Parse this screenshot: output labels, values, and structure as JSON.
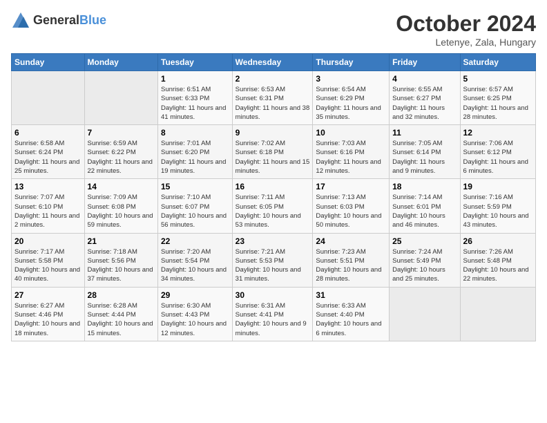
{
  "logo": {
    "text_general": "General",
    "text_blue": "Blue"
  },
  "title": "October 2024",
  "location": "Letenye, Zala, Hungary",
  "days_of_week": [
    "Sunday",
    "Monday",
    "Tuesday",
    "Wednesday",
    "Thursday",
    "Friday",
    "Saturday"
  ],
  "weeks": [
    {
      "days": [
        {
          "num": "",
          "empty": true
        },
        {
          "num": "",
          "empty": true
        },
        {
          "num": "1",
          "sunrise": "6:51 AM",
          "sunset": "6:33 PM",
          "daylight": "11 hours and 41 minutes."
        },
        {
          "num": "2",
          "sunrise": "6:53 AM",
          "sunset": "6:31 PM",
          "daylight": "11 hours and 38 minutes."
        },
        {
          "num": "3",
          "sunrise": "6:54 AM",
          "sunset": "6:29 PM",
          "daylight": "11 hours and 35 minutes."
        },
        {
          "num": "4",
          "sunrise": "6:55 AM",
          "sunset": "6:27 PM",
          "daylight": "11 hours and 32 minutes."
        },
        {
          "num": "5",
          "sunrise": "6:57 AM",
          "sunset": "6:25 PM",
          "daylight": "11 hours and 28 minutes."
        }
      ]
    },
    {
      "days": [
        {
          "num": "6",
          "sunrise": "6:58 AM",
          "sunset": "6:24 PM",
          "daylight": "11 hours and 25 minutes."
        },
        {
          "num": "7",
          "sunrise": "6:59 AM",
          "sunset": "6:22 PM",
          "daylight": "11 hours and 22 minutes."
        },
        {
          "num": "8",
          "sunrise": "7:01 AM",
          "sunset": "6:20 PM",
          "daylight": "11 hours and 19 minutes."
        },
        {
          "num": "9",
          "sunrise": "7:02 AM",
          "sunset": "6:18 PM",
          "daylight": "11 hours and 15 minutes."
        },
        {
          "num": "10",
          "sunrise": "7:03 AM",
          "sunset": "6:16 PM",
          "daylight": "11 hours and 12 minutes."
        },
        {
          "num": "11",
          "sunrise": "7:05 AM",
          "sunset": "6:14 PM",
          "daylight": "11 hours and 9 minutes."
        },
        {
          "num": "12",
          "sunrise": "7:06 AM",
          "sunset": "6:12 PM",
          "daylight": "11 hours and 6 minutes."
        }
      ]
    },
    {
      "days": [
        {
          "num": "13",
          "sunrise": "7:07 AM",
          "sunset": "6:10 PM",
          "daylight": "11 hours and 2 minutes."
        },
        {
          "num": "14",
          "sunrise": "7:09 AM",
          "sunset": "6:08 PM",
          "daylight": "10 hours and 59 minutes."
        },
        {
          "num": "15",
          "sunrise": "7:10 AM",
          "sunset": "6:07 PM",
          "daylight": "10 hours and 56 minutes."
        },
        {
          "num": "16",
          "sunrise": "7:11 AM",
          "sunset": "6:05 PM",
          "daylight": "10 hours and 53 minutes."
        },
        {
          "num": "17",
          "sunrise": "7:13 AM",
          "sunset": "6:03 PM",
          "daylight": "10 hours and 50 minutes."
        },
        {
          "num": "18",
          "sunrise": "7:14 AM",
          "sunset": "6:01 PM",
          "daylight": "10 hours and 46 minutes."
        },
        {
          "num": "19",
          "sunrise": "7:16 AM",
          "sunset": "5:59 PM",
          "daylight": "10 hours and 43 minutes."
        }
      ]
    },
    {
      "days": [
        {
          "num": "20",
          "sunrise": "7:17 AM",
          "sunset": "5:58 PM",
          "daylight": "10 hours and 40 minutes."
        },
        {
          "num": "21",
          "sunrise": "7:18 AM",
          "sunset": "5:56 PM",
          "daylight": "10 hours and 37 minutes."
        },
        {
          "num": "22",
          "sunrise": "7:20 AM",
          "sunset": "5:54 PM",
          "daylight": "10 hours and 34 minutes."
        },
        {
          "num": "23",
          "sunrise": "7:21 AM",
          "sunset": "5:53 PM",
          "daylight": "10 hours and 31 minutes."
        },
        {
          "num": "24",
          "sunrise": "7:23 AM",
          "sunset": "5:51 PM",
          "daylight": "10 hours and 28 minutes."
        },
        {
          "num": "25",
          "sunrise": "7:24 AM",
          "sunset": "5:49 PM",
          "daylight": "10 hours and 25 minutes."
        },
        {
          "num": "26",
          "sunrise": "7:26 AM",
          "sunset": "5:48 PM",
          "daylight": "10 hours and 22 minutes."
        }
      ]
    },
    {
      "days": [
        {
          "num": "27",
          "sunrise": "6:27 AM",
          "sunset": "4:46 PM",
          "daylight": "10 hours and 18 minutes."
        },
        {
          "num": "28",
          "sunrise": "6:28 AM",
          "sunset": "4:44 PM",
          "daylight": "10 hours and 15 minutes."
        },
        {
          "num": "29",
          "sunrise": "6:30 AM",
          "sunset": "4:43 PM",
          "daylight": "10 hours and 12 minutes."
        },
        {
          "num": "30",
          "sunrise": "6:31 AM",
          "sunset": "4:41 PM",
          "daylight": "10 hours and 9 minutes."
        },
        {
          "num": "31",
          "sunrise": "6:33 AM",
          "sunset": "4:40 PM",
          "daylight": "10 hours and 6 minutes."
        },
        {
          "num": "",
          "empty": true
        },
        {
          "num": "",
          "empty": true
        }
      ]
    }
  ]
}
